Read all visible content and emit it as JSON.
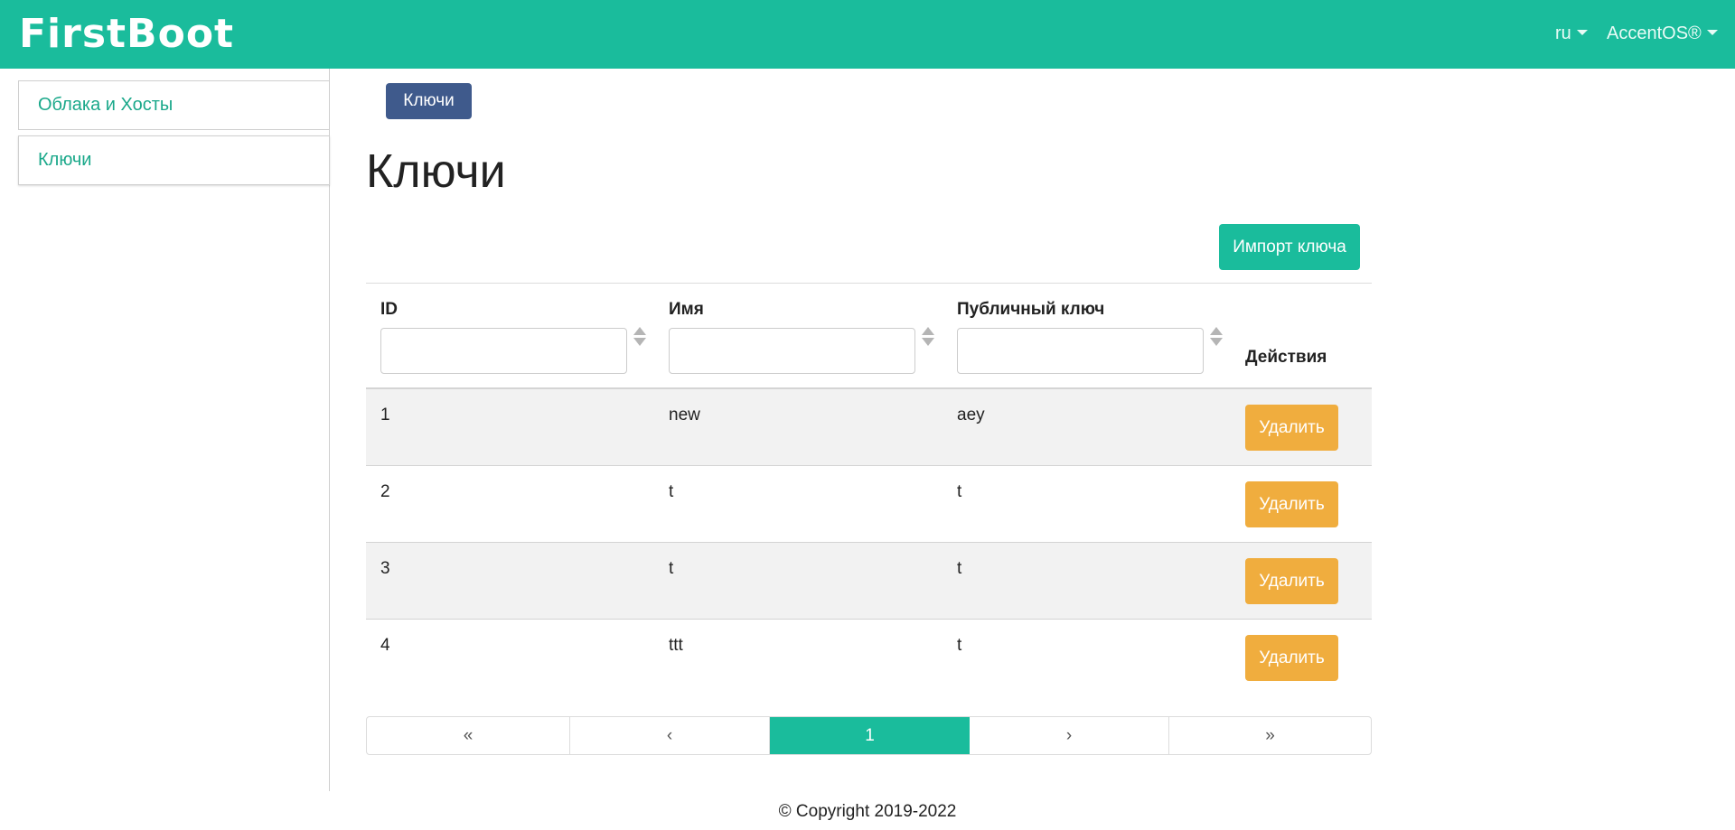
{
  "header": {
    "brand": "FirstBoot",
    "lang": "ru",
    "user": "AccentOS®"
  },
  "sidebar": {
    "items": [
      {
        "label": "Облака и Хосты"
      },
      {
        "label": "Ключи"
      }
    ]
  },
  "breadcrumb": {
    "label": "Ключи"
  },
  "page": {
    "title": "Ключи",
    "import_label": "Импорт ключа"
  },
  "table": {
    "columns": {
      "id": "ID",
      "name": "Имя",
      "public_key": "Публичный ключ",
      "actions": "Действия"
    },
    "filters": {
      "id": "",
      "name": "",
      "public_key": ""
    },
    "rows": [
      {
        "id": "1",
        "name": "new",
        "public_key": "aey",
        "action": "Удалить"
      },
      {
        "id": "2",
        "name": "t",
        "public_key": "t",
        "action": "Удалить"
      },
      {
        "id": "3",
        "name": "t",
        "public_key": "t",
        "action": "Удалить"
      },
      {
        "id": "4",
        "name": "ttt",
        "public_key": "t",
        "action": "Удалить"
      }
    ]
  },
  "pagination": {
    "first": "«",
    "prev": "‹",
    "current": "1",
    "next": "›",
    "last": "»"
  },
  "footer": {
    "text": "© Copyright 2019-2022"
  },
  "colors": {
    "accent": "#1abc9c",
    "breadcrumb": "#3f5a8c",
    "danger_button": "#f0ad3e"
  }
}
